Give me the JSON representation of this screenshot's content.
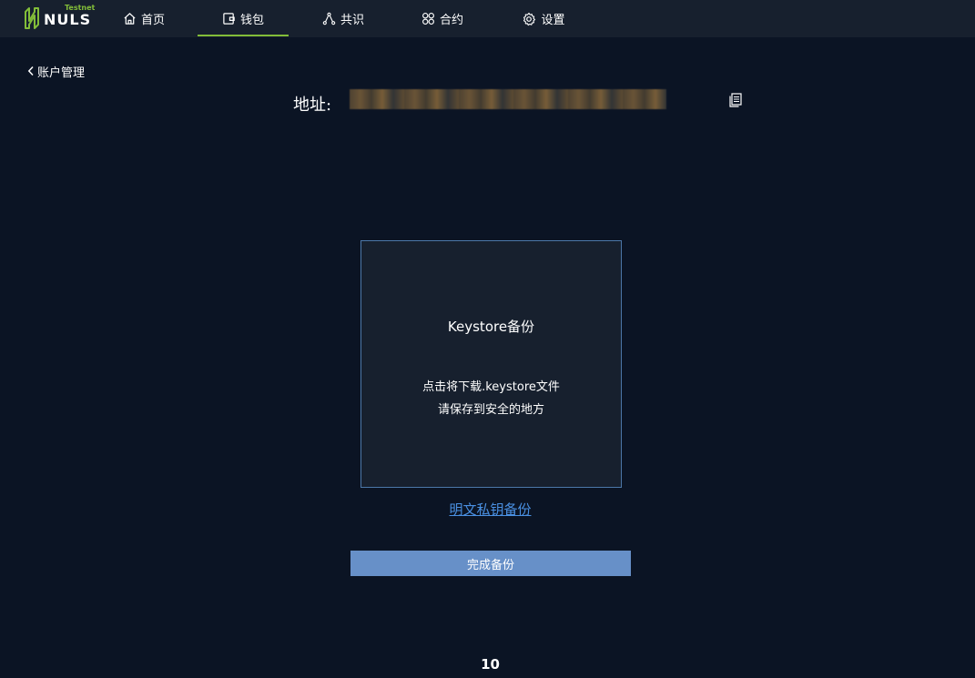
{
  "header": {
    "logo": {
      "word": "NULS",
      "tag": "Testnet"
    },
    "nav": [
      {
        "key": "home",
        "label": "首页",
        "icon": "home-icon"
      },
      {
        "key": "wallet",
        "label": "钱包",
        "icon": "wallet-icon",
        "active": true
      },
      {
        "key": "consensus",
        "label": "共识",
        "icon": "consensus-icon"
      },
      {
        "key": "contract",
        "label": "合约",
        "icon": "contract-icon"
      },
      {
        "key": "settings",
        "label": "设置",
        "icon": "gear-icon"
      }
    ]
  },
  "breadcrumb": {
    "back_label": "账户管理",
    "icon": "chevron-left-icon"
  },
  "address": {
    "label": "地址:",
    "value": "",
    "copy_icon": "copy-icon"
  },
  "keystore_card": {
    "title": "Keystore备份",
    "line1": "点击将下载.keystore文件",
    "line2": "请保存到安全的地方"
  },
  "private_key_link": "明文私钥备份",
  "complete_button": "完成备份",
  "page_number": "10",
  "colors": {
    "background": "#0b1424",
    "header": "#17202e",
    "accent_green": "#82bd39",
    "card_border": "#4c77a8",
    "link_blue": "#4a90e2",
    "button_blue": "#6790c8"
  }
}
